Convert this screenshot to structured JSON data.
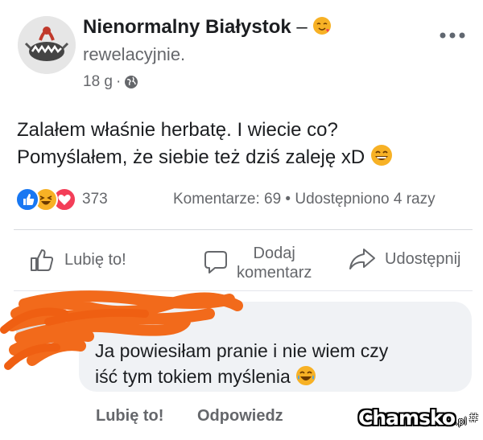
{
  "post": {
    "page_name": "Nienormalny Białystok",
    "separator": "–",
    "subtitle": "rewelacyjnie.",
    "time": "18 g",
    "dot": "·",
    "text_line1": "Zalałem właśnie herbatę. I wiecie co?",
    "text_line2": "Pomyślałem, że siebie też dziś zaleję xD",
    "reaction_count": "373",
    "stats": "Komentarze: 69 • Udostępniono 4 razy"
  },
  "actions": {
    "like": "Lubię to!",
    "comment_line1": "Dodaj",
    "comment_line2": "komentarz",
    "share": "Udostępnij"
  },
  "comment": {
    "text_line1": "Ja powiesiłam pranie i nie wiem czy",
    "text_line2": "iść tym tokiem myślenia",
    "like": "Lubię to!",
    "reply": "Odpowiedz"
  },
  "watermark": {
    "brand": "Chamsko",
    "suffix": ".pl"
  },
  "colors": {
    "like_blue": "#1877f2",
    "haha_yellow": "#f7b125",
    "love_red": "#f33e58",
    "scribble_orange": "#f26a1b"
  },
  "icons": [
    "avatar-logo-icon",
    "feeling-emoji-icon",
    "globe-icon",
    "more-icon",
    "like-reaction-icon",
    "haha-reaction-icon",
    "love-reaction-icon",
    "thumbs-up-icon",
    "comment-icon",
    "share-icon",
    "laughing-emoji-icon"
  ]
}
